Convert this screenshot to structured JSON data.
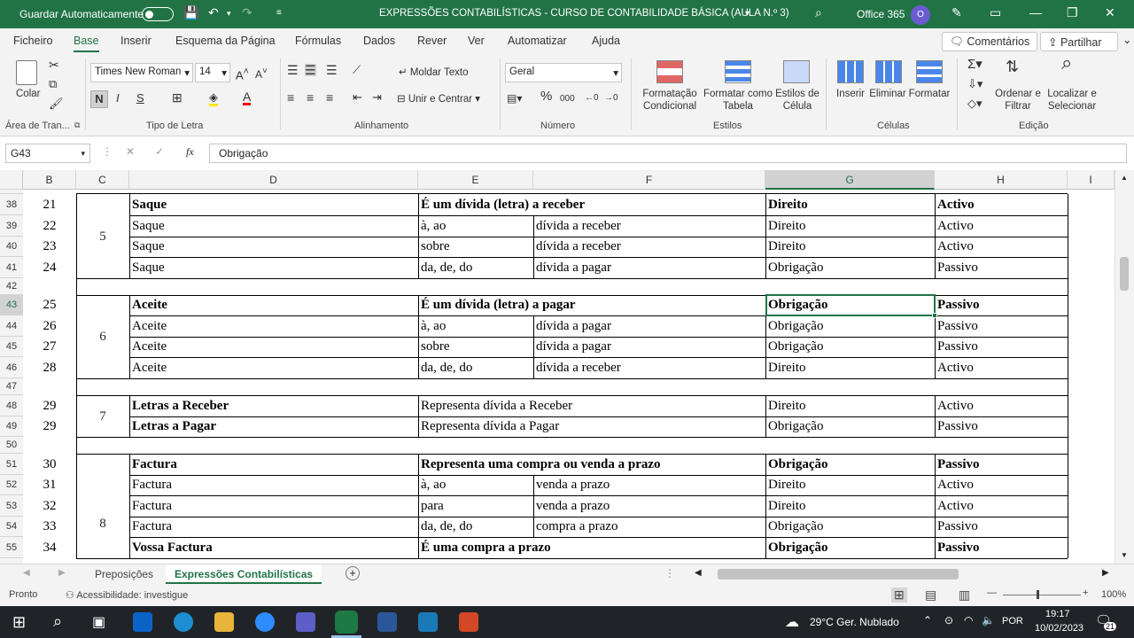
{
  "titlebar": {
    "autosave_label": "Guardar Automaticamente",
    "title": "EXPRESSÕES CONTABILÍSTICAS - CURSO DE CONTABILIDADE BÁSICA (AULA N.º 3)",
    "office": "Office 365",
    "avatar": "O"
  },
  "tabs": [
    "Ficheiro",
    "Base",
    "Inserir",
    "Esquema da Página",
    "Fórmulas",
    "Dados",
    "Rever",
    "Ver",
    "Automatizar",
    "Ajuda"
  ],
  "active_tab": "Base",
  "comments_label": "Comentários",
  "share_label": "Partilhar",
  "ribbon": {
    "clipboard": {
      "paste": "Colar",
      "group": "Área de Tran..."
    },
    "font": {
      "name": "Times New Roman",
      "size": "14",
      "bold": "N",
      "italic": "I",
      "underline": "S",
      "group": "Tipo de Letra"
    },
    "alignment": {
      "wrap": "Moldar Texto",
      "merge": "Unir e Centrar",
      "group": "Alinhamento"
    },
    "number": {
      "format": "Geral",
      "group": "Número"
    },
    "styles": {
      "cond": "Formatação Condicional",
      "table": "Formatar como Tabela",
      "cell": "Estilos de Célula",
      "group": "Estilos"
    },
    "cells": {
      "insert": "Inserir",
      "delete": "Eliminar",
      "format": "Formatar",
      "group": "Células"
    },
    "edit": {
      "sort": "Ordenar e Filtrar",
      "find": "Localizar e Selecionar",
      "group": "Edição"
    }
  },
  "namebox": "G43",
  "formula": "Obrigação",
  "columns": [
    {
      "l": "B"
    },
    {
      "l": "C"
    },
    {
      "l": "D"
    },
    {
      "l": "E"
    },
    {
      "l": "F"
    },
    {
      "l": "G",
      "sel": true
    },
    {
      "l": "H"
    },
    {
      "l": "I"
    }
  ],
  "rows": [
    {
      "n": "38",
      "b": "21",
      "d": "Saque",
      "e": "É um dívida (letra) a receber",
      "f": "",
      "g": "Direito",
      "h": "Activo",
      "bold": true
    },
    {
      "n": "39",
      "b": "22",
      "d": "Saque",
      "e": "à, ao",
      "f": "dívida a receber",
      "g": "Direito",
      "h": "Activo"
    },
    {
      "n": "40",
      "b": "23",
      "d": "Saque",
      "e": "sobre",
      "f": "dívida a receber",
      "g": "Direito",
      "h": "Activo"
    },
    {
      "n": "41",
      "b": "24",
      "d": "Saque",
      "e": "da, de, do",
      "f": "dívida a pagar",
      "g": "Obrigação",
      "h": "Passivo"
    },
    {
      "n": "42",
      "empty": true
    },
    {
      "n": "43",
      "b": "25",
      "d": "Aceite",
      "e": "É um dívida (letra) a pagar",
      "f": "",
      "g": "Obrigação",
      "h": "Passivo",
      "bold": true
    },
    {
      "n": "44",
      "b": "26",
      "d": "Aceite",
      "e": "à, ao",
      "f": "dívida a pagar",
      "g": "Obrigação",
      "h": "Passivo"
    },
    {
      "n": "45",
      "b": "27",
      "d": "Aceite",
      "e": "sobre",
      "f": "dívida a pagar",
      "g": "Obrigação",
      "h": "Passivo"
    },
    {
      "n": "46",
      "b": "28",
      "d": "Aceite",
      "e": "da, de, do",
      "f": "dívida a receber",
      "g": "Direito",
      "h": "Activo"
    },
    {
      "n": "47",
      "empty": true
    },
    {
      "n": "48",
      "b": "29",
      "d": "Letras a Receber",
      "e": "Representa dívida a Receber",
      "f": "",
      "g": "Direito",
      "h": "Activo",
      "boldd": true
    },
    {
      "n": "49",
      "b": "29",
      "d": "Letras a Pagar",
      "e": "Representa dívida a Pagar",
      "f": "",
      "g": "Obrigação",
      "h": "Passivo",
      "boldd": true
    },
    {
      "n": "50",
      "empty": true
    },
    {
      "n": "51",
      "b": "30",
      "d": "Factura",
      "e": "Representa uma compra ou venda a prazo",
      "f": "",
      "g": "Obrigação",
      "h": "Passivo",
      "bold": true
    },
    {
      "n": "52",
      "b": "31",
      "d": "Factura",
      "e": "à, ao",
      "f": "venda a prazo",
      "g": "Direito",
      "h": "Activo"
    },
    {
      "n": "53",
      "b": "32",
      "d": "Factura",
      "e": "para",
      "f": "venda a prazo",
      "g": "Direito",
      "h": "Activo"
    },
    {
      "n": "54",
      "b": "33",
      "d": "Factura",
      "e": "da, de, do",
      "f": "compra a prazo",
      "g": "Obrigação",
      "h": "Passivo"
    },
    {
      "n": "55",
      "b": "34",
      "d": "Vossa Factura",
      "e": "É uma compra a prazo",
      "f": "",
      "g": "Obrigação",
      "h": "Passivo",
      "bold": true
    }
  ],
  "groups": [
    {
      "label": "5"
    },
    {
      "label": "6"
    },
    {
      "label": "7"
    },
    {
      "label": "8"
    }
  ],
  "sheets": [
    "Preposições",
    "Expressões Contabilísticas"
  ],
  "active_sheet": "Expressões Contabilísticas",
  "status": {
    "ready": "Pronto",
    "accessibility": "Acessibilidade: investigue",
    "zoom": "100%"
  },
  "taskbar": {
    "weather": "29°C  Ger. Nublado",
    "lang": "POR",
    "time": "19:17",
    "date": "10/02/2023",
    "notif": "21"
  }
}
